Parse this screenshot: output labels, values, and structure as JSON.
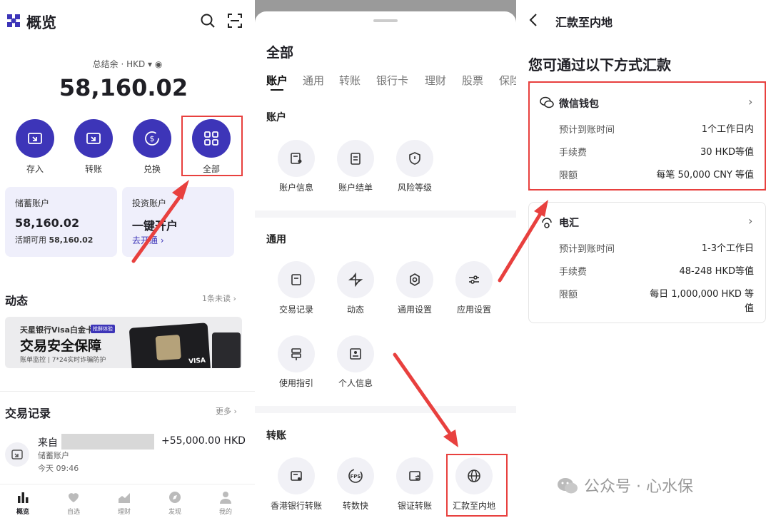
{
  "p1": {
    "title": "概览",
    "balance_label": "总结余 · HKD",
    "balance": "58,160.02",
    "actions": [
      {
        "label": "存入"
      },
      {
        "label": "转账"
      },
      {
        "label": "兑换"
      },
      {
        "label": "全部"
      }
    ],
    "savings": {
      "title": "储蓄账户",
      "amount": "58,160.02",
      "avail_label": "活期可用",
      "avail_value": "58,160.02"
    },
    "invest": {
      "title": "投资账户",
      "cta": "一键开户",
      "link": "去开通 ›"
    },
    "dynamics": {
      "title": "动态",
      "unread": "1条未读 ›"
    },
    "banner": {
      "line1": "天星银行Visa白金卡",
      "tag": "抢鲜体验",
      "line2": "交易安全保障",
      "line3": "账单监控 | 7*24实时诈骗防护",
      "card_brand": "VISA"
    },
    "tx": {
      "title": "交易记录",
      "more": "更多 ›",
      "from": "来自",
      "amount": "+55,000.00 HKD",
      "sub": "储蓄账户",
      "time": "今天 09:46"
    },
    "nav": [
      {
        "label": "概览"
      },
      {
        "label": "自选"
      },
      {
        "label": "理财"
      },
      {
        "label": "发现"
      },
      {
        "label": "我的"
      }
    ]
  },
  "p2": {
    "title": "全部",
    "tabs": [
      "账户",
      "通用",
      "转账",
      "银行卡",
      "理财",
      "股票",
      "保险"
    ],
    "sec_account": "账户",
    "account_items": [
      {
        "label": "账户信息"
      },
      {
        "label": "账户结单"
      },
      {
        "label": "风险等级"
      }
    ],
    "sec_general": "通用",
    "general_items": [
      {
        "label": "交易记录"
      },
      {
        "label": "动态"
      },
      {
        "label": "通用设置"
      },
      {
        "label": "应用设置"
      },
      {
        "label": "使用指引"
      },
      {
        "label": "个人信息"
      }
    ],
    "sec_transfer": "转账",
    "transfer_items": [
      {
        "label": "香港银行转账"
      },
      {
        "label": "转数快"
      },
      {
        "label": "银证转账"
      },
      {
        "label": "汇款至内地"
      }
    ]
  },
  "p3": {
    "title": "汇款至内地",
    "heading": "您可通过以下方式汇款",
    "wechat": {
      "title": "微信钱包",
      "rows": [
        [
          "预计到账时间",
          "1个工作日内"
        ],
        [
          "手续费",
          "30 HKD等值"
        ],
        [
          "限额",
          "每笔 50,000 CNY 等值"
        ]
      ]
    },
    "wire": {
      "title": "电汇",
      "rows": [
        [
          "预计到账时间",
          "1-3个工作日"
        ],
        [
          "手续费",
          "48-248 HKD等值"
        ],
        [
          "限额",
          "每日 1,000,000 HKD 等",
          "值"
        ]
      ]
    },
    "watermark": "公众号 · 心水保"
  },
  "colors": {
    "primary": "#3d35b8",
    "card_bg": "#efeffb",
    "red": "#e8403e"
  }
}
